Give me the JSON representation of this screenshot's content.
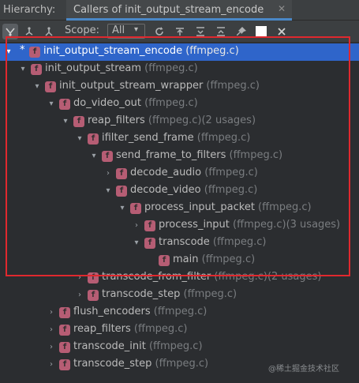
{
  "header": {
    "label": "Hierarchy:",
    "tab_title": "Callers of init_output_stream_encode",
    "tab_close": "✕"
  },
  "toolbar": {
    "scope_label": "Scope:",
    "scope_value": "All",
    "scope_arrow": "▾",
    "icons": [
      "caller-hierarchy-icon",
      "callee-hierarchy-icon",
      "hierarchy-alt-icon",
      "refresh-icon",
      "autoscroll-icon",
      "expand-all-icon",
      "collapse-all-icon",
      "pin-icon",
      "close-icon"
    ]
  },
  "tree": {
    "rows": [
      {
        "depth": 0,
        "arrow": "▾",
        "star": true,
        "name": "init_output_stream_encode",
        "loc": " (ffmpeg.c)",
        "selected": true
      },
      {
        "depth": 1,
        "arrow": "▾",
        "star": false,
        "name": "init_output_stream",
        "loc": " (ffmpeg.c)",
        "selected": false
      },
      {
        "depth": 2,
        "arrow": "▾",
        "star": false,
        "name": "init_output_stream_wrapper",
        "loc": " (ffmpeg.c)",
        "selected": false
      },
      {
        "depth": 3,
        "arrow": "▾",
        "star": false,
        "name": "do_video_out",
        "loc": " (ffmpeg.c)",
        "selected": false
      },
      {
        "depth": 4,
        "arrow": "▾",
        "star": false,
        "name": "reap_filters",
        "loc": " (ffmpeg.c)(2 usages)",
        "selected": false
      },
      {
        "depth": 5,
        "arrow": "▾",
        "star": false,
        "name": "ifilter_send_frame",
        "loc": " (ffmpeg.c)",
        "selected": false
      },
      {
        "depth": 6,
        "arrow": "▾",
        "star": false,
        "name": "send_frame_to_filters",
        "loc": " (ffmpeg.c)",
        "selected": false
      },
      {
        "depth": 7,
        "arrow": "›",
        "star": false,
        "name": "decode_audio",
        "loc": " (ffmpeg.c)",
        "selected": false
      },
      {
        "depth": 7,
        "arrow": "▾",
        "star": false,
        "name": "decode_video",
        "loc": " (ffmpeg.c)",
        "selected": false
      },
      {
        "depth": 8,
        "arrow": "▾",
        "star": false,
        "name": "process_input_packet",
        "loc": " (ffmpeg.c)",
        "selected": false
      },
      {
        "depth": 9,
        "arrow": "›",
        "star": false,
        "name": "process_input",
        "loc": " (ffmpeg.c)(3 usages)",
        "selected": false
      },
      {
        "depth": 9,
        "arrow": "▾",
        "star": false,
        "name": "transcode",
        "loc": " (ffmpeg.c)",
        "selected": false
      },
      {
        "depth": 10,
        "arrow": "",
        "star": false,
        "name": "main",
        "loc": " (ffmpeg.c)",
        "selected": false
      },
      {
        "depth": 5,
        "arrow": "›",
        "star": false,
        "name": "transcode_from_filter",
        "loc": " (ffmpeg.c)(2 usages)",
        "selected": false
      },
      {
        "depth": 5,
        "arrow": "›",
        "star": false,
        "name": "transcode_step",
        "loc": " (ffmpeg.c)",
        "selected": false
      },
      {
        "depth": 3,
        "arrow": "›",
        "star": false,
        "name": "flush_encoders",
        "loc": " (ffmpeg.c)",
        "selected": false
      },
      {
        "depth": 3,
        "arrow": "›",
        "star": false,
        "name": "reap_filters",
        "loc": " (ffmpeg.c)",
        "selected": false
      },
      {
        "depth": 3,
        "arrow": "›",
        "star": false,
        "name": "transcode_init",
        "loc": " (ffmpeg.c)",
        "selected": false
      },
      {
        "depth": 3,
        "arrow": "›",
        "star": false,
        "name": "transcode_step",
        "loc": " (ffmpeg.c)",
        "selected": false
      }
    ],
    "icon_letter": "f"
  },
  "watermark": "@稀土掘金技术社区",
  "colors": {
    "selection": "#2f65ca",
    "highlight_box": "#e0282e",
    "function_icon": "#b65d74",
    "tab_underline": "#4a88c7"
  }
}
